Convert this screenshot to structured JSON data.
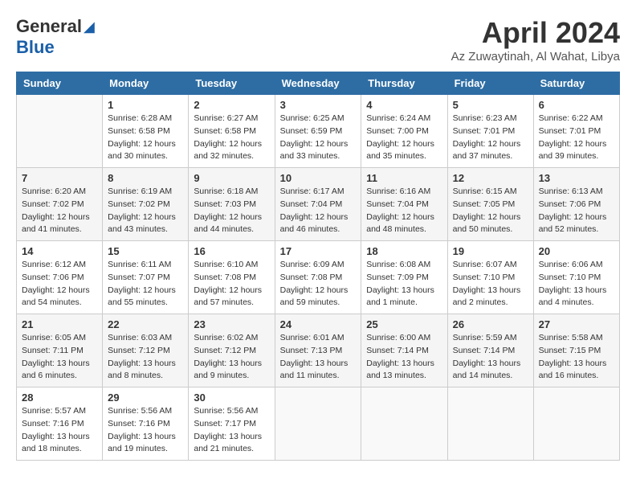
{
  "header": {
    "logo_general": "General",
    "logo_blue": "Blue",
    "month_title": "April 2024",
    "location": "Az Zuwaytinah, Al Wahat, Libya"
  },
  "weekdays": [
    "Sunday",
    "Monday",
    "Tuesday",
    "Wednesday",
    "Thursday",
    "Friday",
    "Saturday"
  ],
  "weeks": [
    [
      {
        "day": "",
        "info": ""
      },
      {
        "day": "1",
        "info": "Sunrise: 6:28 AM\nSunset: 6:58 PM\nDaylight: 12 hours\nand 30 minutes."
      },
      {
        "day": "2",
        "info": "Sunrise: 6:27 AM\nSunset: 6:58 PM\nDaylight: 12 hours\nand 32 minutes."
      },
      {
        "day": "3",
        "info": "Sunrise: 6:25 AM\nSunset: 6:59 PM\nDaylight: 12 hours\nand 33 minutes."
      },
      {
        "day": "4",
        "info": "Sunrise: 6:24 AM\nSunset: 7:00 PM\nDaylight: 12 hours\nand 35 minutes."
      },
      {
        "day": "5",
        "info": "Sunrise: 6:23 AM\nSunset: 7:01 PM\nDaylight: 12 hours\nand 37 minutes."
      },
      {
        "day": "6",
        "info": "Sunrise: 6:22 AM\nSunset: 7:01 PM\nDaylight: 12 hours\nand 39 minutes."
      }
    ],
    [
      {
        "day": "7",
        "info": "Sunrise: 6:20 AM\nSunset: 7:02 PM\nDaylight: 12 hours\nand 41 minutes."
      },
      {
        "day": "8",
        "info": "Sunrise: 6:19 AM\nSunset: 7:02 PM\nDaylight: 12 hours\nand 43 minutes."
      },
      {
        "day": "9",
        "info": "Sunrise: 6:18 AM\nSunset: 7:03 PM\nDaylight: 12 hours\nand 44 minutes."
      },
      {
        "day": "10",
        "info": "Sunrise: 6:17 AM\nSunset: 7:04 PM\nDaylight: 12 hours\nand 46 minutes."
      },
      {
        "day": "11",
        "info": "Sunrise: 6:16 AM\nSunset: 7:04 PM\nDaylight: 12 hours\nand 48 minutes."
      },
      {
        "day": "12",
        "info": "Sunrise: 6:15 AM\nSunset: 7:05 PM\nDaylight: 12 hours\nand 50 minutes."
      },
      {
        "day": "13",
        "info": "Sunrise: 6:13 AM\nSunset: 7:06 PM\nDaylight: 12 hours\nand 52 minutes."
      }
    ],
    [
      {
        "day": "14",
        "info": "Sunrise: 6:12 AM\nSunset: 7:06 PM\nDaylight: 12 hours\nand 54 minutes."
      },
      {
        "day": "15",
        "info": "Sunrise: 6:11 AM\nSunset: 7:07 PM\nDaylight: 12 hours\nand 55 minutes."
      },
      {
        "day": "16",
        "info": "Sunrise: 6:10 AM\nSunset: 7:08 PM\nDaylight: 12 hours\nand 57 minutes."
      },
      {
        "day": "17",
        "info": "Sunrise: 6:09 AM\nSunset: 7:08 PM\nDaylight: 12 hours\nand 59 minutes."
      },
      {
        "day": "18",
        "info": "Sunrise: 6:08 AM\nSunset: 7:09 PM\nDaylight: 13 hours\nand 1 minute."
      },
      {
        "day": "19",
        "info": "Sunrise: 6:07 AM\nSunset: 7:10 PM\nDaylight: 13 hours\nand 2 minutes."
      },
      {
        "day": "20",
        "info": "Sunrise: 6:06 AM\nSunset: 7:10 PM\nDaylight: 13 hours\nand 4 minutes."
      }
    ],
    [
      {
        "day": "21",
        "info": "Sunrise: 6:05 AM\nSunset: 7:11 PM\nDaylight: 13 hours\nand 6 minutes."
      },
      {
        "day": "22",
        "info": "Sunrise: 6:03 AM\nSunset: 7:12 PM\nDaylight: 13 hours\nand 8 minutes."
      },
      {
        "day": "23",
        "info": "Sunrise: 6:02 AM\nSunset: 7:12 PM\nDaylight: 13 hours\nand 9 minutes."
      },
      {
        "day": "24",
        "info": "Sunrise: 6:01 AM\nSunset: 7:13 PM\nDaylight: 13 hours\nand 11 minutes."
      },
      {
        "day": "25",
        "info": "Sunrise: 6:00 AM\nSunset: 7:14 PM\nDaylight: 13 hours\nand 13 minutes."
      },
      {
        "day": "26",
        "info": "Sunrise: 5:59 AM\nSunset: 7:14 PM\nDaylight: 13 hours\nand 14 minutes."
      },
      {
        "day": "27",
        "info": "Sunrise: 5:58 AM\nSunset: 7:15 PM\nDaylight: 13 hours\nand 16 minutes."
      }
    ],
    [
      {
        "day": "28",
        "info": "Sunrise: 5:57 AM\nSunset: 7:16 PM\nDaylight: 13 hours\nand 18 minutes."
      },
      {
        "day": "29",
        "info": "Sunrise: 5:56 AM\nSunset: 7:16 PM\nDaylight: 13 hours\nand 19 minutes."
      },
      {
        "day": "30",
        "info": "Sunrise: 5:56 AM\nSunset: 7:17 PM\nDaylight: 13 hours\nand 21 minutes."
      },
      {
        "day": "",
        "info": ""
      },
      {
        "day": "",
        "info": ""
      },
      {
        "day": "",
        "info": ""
      },
      {
        "day": "",
        "info": ""
      }
    ]
  ]
}
